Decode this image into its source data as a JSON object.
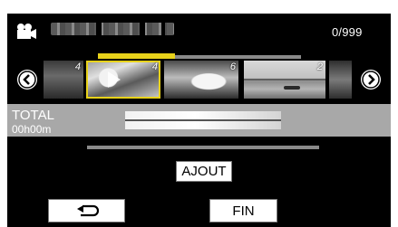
{
  "header": {
    "mode_icon": "video-camera-icon",
    "counter": "0/999"
  },
  "thumbnails": [
    {
      "number": "4"
    },
    {
      "number": "4"
    },
    {
      "number": "6"
    },
    {
      "number": "2"
    },
    {
      "number": ""
    }
  ],
  "navigation": {
    "prev_icon": "chevron-left-icon",
    "next_icon": "chevron-right-icon"
  },
  "total": {
    "label": "TOTAL",
    "time": "00h00m"
  },
  "buttons": {
    "add_label": "AJOUT",
    "back_icon": "return-arrow-icon",
    "finish_label": "FIN"
  },
  "colors": {
    "selection": "#e8d21a",
    "panel": "#a8a8a8",
    "background": "#000000"
  }
}
